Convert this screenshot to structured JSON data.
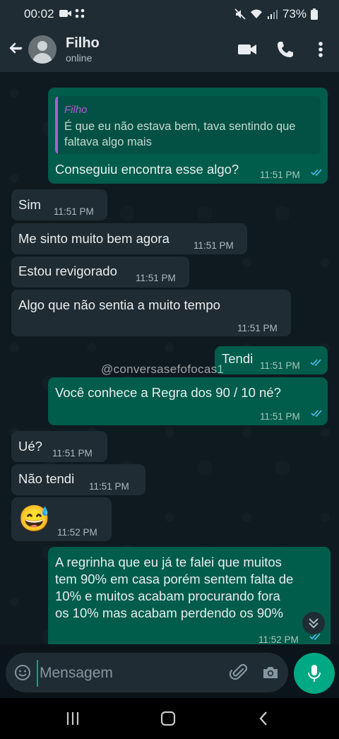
{
  "status_bar": {
    "time": "00:02",
    "battery": "73%",
    "icons": [
      "video-record-icon",
      "grid-icon",
      "mute-icon",
      "wifi-icon",
      "signal-icon",
      "battery-icon"
    ]
  },
  "header": {
    "name": "Filho",
    "status": "online"
  },
  "messages": [
    {
      "dir": "out",
      "quote_name": "Filho",
      "quote_text": "É que eu não estava bem, tava sentindo que\nfaltava algo mais",
      "text": "Conseguiu encontra esse algo?",
      "time": "11:51 PM"
    },
    {
      "dir": "in",
      "text": "Sim",
      "time": "11:51 PM"
    },
    {
      "dir": "in",
      "text": "Me sinto muito bem agora",
      "time": "11:51 PM"
    },
    {
      "dir": "in",
      "text": "Estou revigorado",
      "time": "11:51 PM"
    },
    {
      "dir": "in",
      "text": "Algo que não sentia a muito tempo",
      "time": "11:51 PM"
    },
    {
      "dir": "out",
      "text": "Tendi",
      "time": "11:51 PM"
    },
    {
      "dir": "out",
      "text": "Você conhece a Regra dos 90 / 10 né?",
      "time": "11:51 PM"
    },
    {
      "dir": "in",
      "text": "Ué?",
      "time": "11:51 PM"
    },
    {
      "dir": "in",
      "text": "Não tendi",
      "time": "11:51 PM"
    },
    {
      "dir": "in",
      "text": "😅",
      "time": "11:52 PM"
    },
    {
      "dir": "out",
      "text": "A regrinha que eu já te falei que muitos\ntem 90% em casa porém sentem falta de\n10% e muitos acabam procurando fora\nos 10% mas acabam perdendo os 90%",
      "time": "11:52 PM"
    }
  ],
  "watermark": "@conversasefofocas1",
  "composer": {
    "placeholder": "Mensagem"
  },
  "colors": {
    "incoming": "#202c33",
    "outgoing": "#005c4b",
    "accent": "#00a884",
    "quote_name": "#a95fd1",
    "read_ticks": "#53bdeb"
  }
}
